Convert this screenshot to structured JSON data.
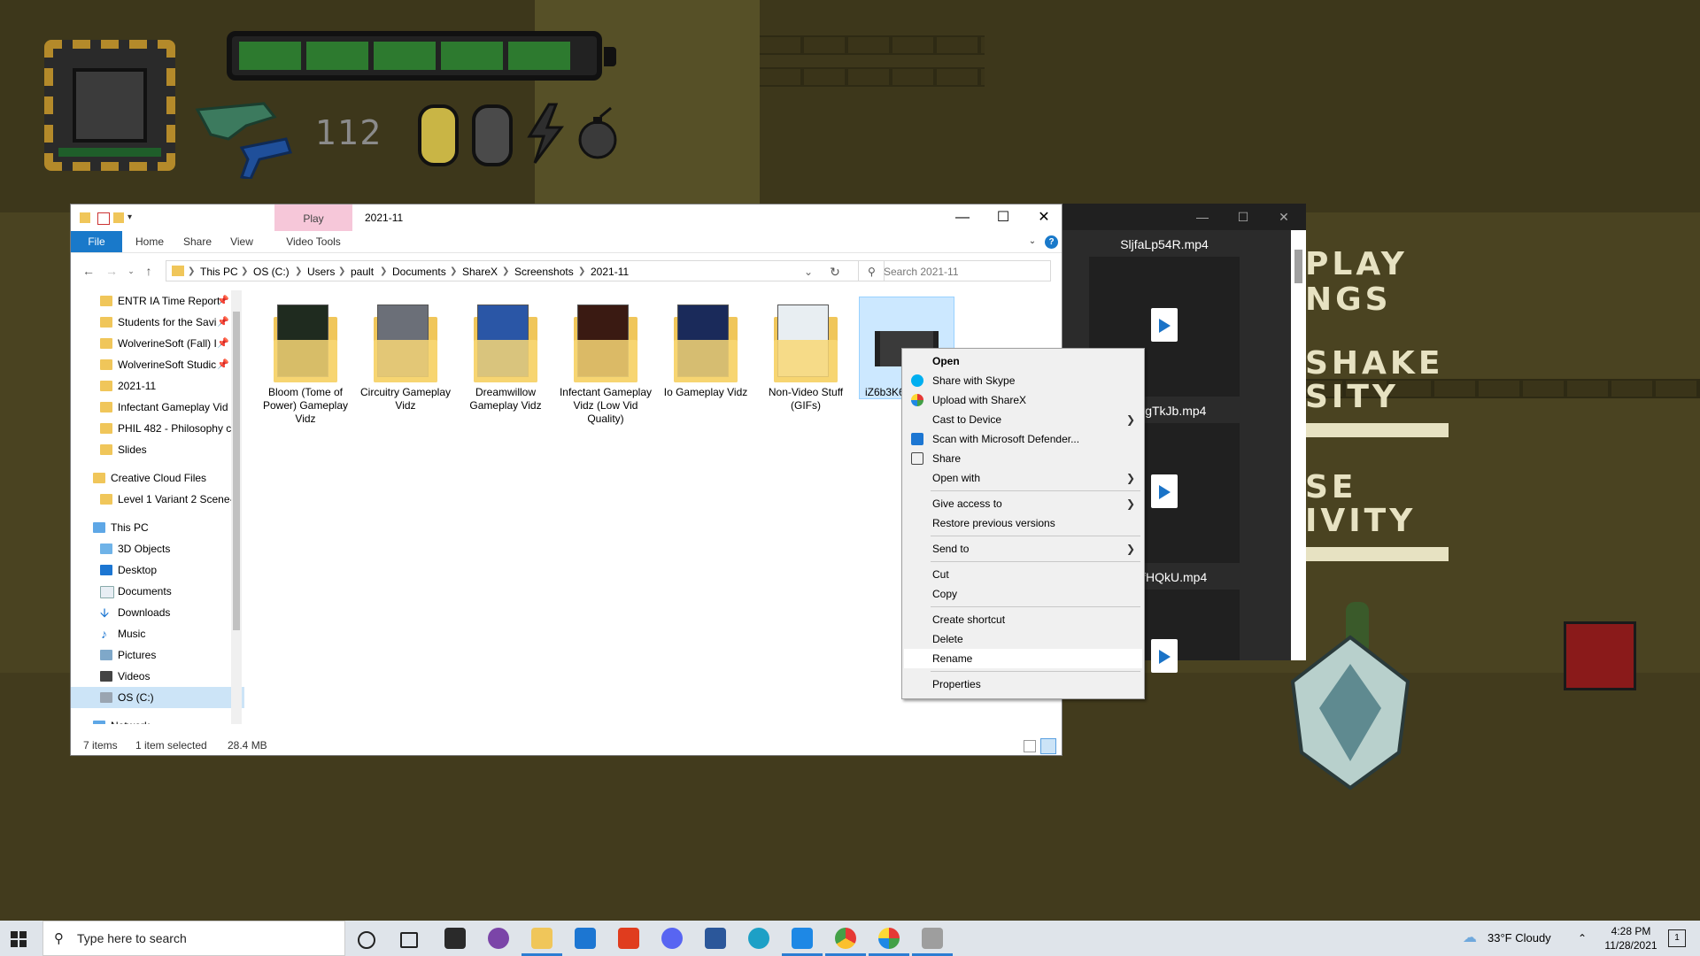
{
  "game": {
    "ammo_count": "112",
    "overlay_texts": [
      "PLAY",
      "NGS",
      "SHAKE",
      "SITY",
      "SE",
      "IVITY"
    ],
    "battery_level": 1.0,
    "colors": {
      "background": "#4a4321",
      "battery_cell": "#2d7a2f",
      "chip_border": "#b48a2a"
    }
  },
  "explorer": {
    "title": "2021-11",
    "contextual_tab": "Play",
    "contextual_group": "Video Tools",
    "ribbon_tabs": [
      "File",
      "Home",
      "Share",
      "View",
      "Video Tools"
    ],
    "breadcrumb": [
      "This PC",
      "OS (C:)",
      "Users",
      "pault",
      "Documents",
      "ShareX",
      "Screenshots",
      "2021-11"
    ],
    "search_placeholder": "Search 2021-11",
    "nav": {
      "quick_access": [
        {
          "label": "ENTR IA Time Report",
          "pinned": true
        },
        {
          "label": "Students for the Savi",
          "pinned": true
        },
        {
          "label": "WolverineSoft (Fall) I",
          "pinned": true
        },
        {
          "label": "WolverineSoft Studic",
          "pinned": true
        },
        {
          "label": "2021-11",
          "pinned": false
        },
        {
          "label": "Infectant Gameplay Vid",
          "pinned": false
        },
        {
          "label": "PHIL 482 - Philosophy c",
          "pinned": false
        },
        {
          "label": "Slides",
          "pinned": false
        }
      ],
      "creative_cloud": "Creative Cloud Files",
      "creative_cloud_child": "Level 1 Variant 2 Scene-",
      "this_pc": "This PC",
      "this_pc_children": [
        "3D Objects",
        "Desktop",
        "Documents",
        "Downloads",
        "Music",
        "Pictures",
        "Videos",
        "OS (C:)"
      ],
      "network": "Network"
    },
    "files": [
      {
        "name": "Bloom (Tome of Power) Gameplay Vidz",
        "type": "folder",
        "preview": "#1f2b1f"
      },
      {
        "name": "Circuitry Gameplay Vidz",
        "type": "folder",
        "preview": "#6b6f78"
      },
      {
        "name": "Dreamwillow Gameplay Vidz",
        "type": "folder",
        "preview": "#2a56a6"
      },
      {
        "name": "Infectant Gameplay Vidz (Low Vid Quality)",
        "type": "folder",
        "preview": "#3a1a12"
      },
      {
        "name": "Io Gameplay Vidz",
        "type": "folder",
        "preview": "#1a2a5a"
      },
      {
        "name": "Non-Video Stuff (GIFs)",
        "type": "folder",
        "preview": "#e8eef2"
      },
      {
        "name": "iZ6b3K6",
        "type": "video",
        "preview": "#3a3a3a"
      }
    ],
    "status": {
      "count": "7 items",
      "selection": "1 item selected",
      "size": "28.4 MB"
    }
  },
  "sharex_window": {
    "items": [
      {
        "name": "SljfaLp54R.mp4"
      },
      {
        "name": "2pwgTkJb.mp4"
      },
      {
        "name": "oogfHQkU.mp4"
      }
    ]
  },
  "context_menu": {
    "items": [
      {
        "label": "Open",
        "bold": true
      },
      {
        "label": "Share with Skype",
        "icon": "skype-icon"
      },
      {
        "label": "Upload with ShareX",
        "icon": "sharex-icon"
      },
      {
        "label": "Cast to Device",
        "submenu": true
      },
      {
        "label": "Scan with Microsoft Defender...",
        "icon": "defender-icon"
      },
      {
        "label": "Share",
        "icon": "share-icon"
      },
      {
        "label": "Open with",
        "submenu": true
      },
      {
        "label": "Give access to",
        "submenu": true
      },
      {
        "label": "Restore previous versions"
      },
      {
        "label": "Send to",
        "submenu": true
      },
      {
        "label": "Cut"
      },
      {
        "label": "Copy"
      },
      {
        "label": "Create shortcut"
      },
      {
        "label": "Delete"
      },
      {
        "label": "Rename",
        "highlighted": true
      },
      {
        "label": "Properties"
      }
    ]
  },
  "taskbar": {
    "search_placeholder": "Type here to search",
    "weather": "33°F  Cloudy",
    "time": "4:28 PM",
    "date": "11/28/2021",
    "notification_count": "1"
  }
}
